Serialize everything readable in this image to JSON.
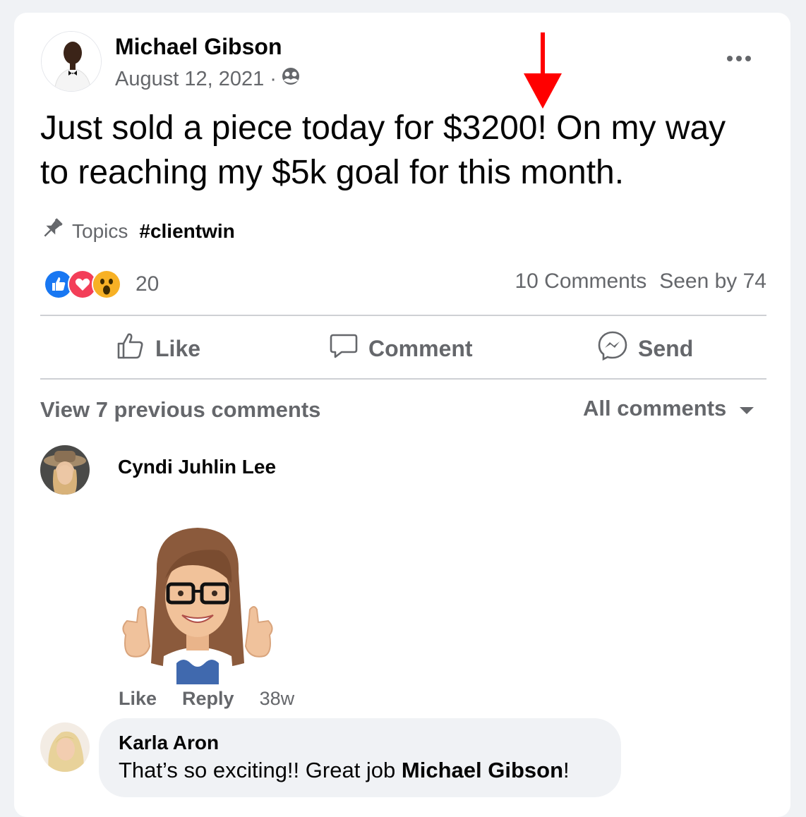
{
  "post": {
    "author": "Michael Gibson",
    "date": "August 12, 2021 ·",
    "text": "Just sold a piece today for $3200! On my way to reaching my $5k goal for this month.",
    "topics_label": "Topics",
    "hashtag": "#clientwin",
    "reaction_count": "20",
    "comments_count": "10 Comments",
    "seen_by": "Seen by 74"
  },
  "actions": {
    "like": "Like",
    "comment": "Comment",
    "send": "Send"
  },
  "comments_section": {
    "view_previous": "View 7 previous comments",
    "filter": "All comments"
  },
  "comments": [
    {
      "author": "Cyndi Juhlin Lee",
      "like": "Like",
      "reply": "Reply",
      "time": "38w"
    },
    {
      "author": "Karla Aron",
      "text_before": "That’s so exciting!! Great job ",
      "mention": "Michael Gibson",
      "text_after": "!"
    }
  ],
  "colors": {
    "secondary_text": "#65676b",
    "divider": "#ced0d4",
    "like_blue": "#1877f2",
    "love_red": "#f33e58",
    "annotation_arrow": "#ff0000"
  },
  "icons": [
    "more-icon",
    "friends-icon",
    "pin-icon",
    "like-reaction-icon",
    "love-reaction-icon",
    "wow-reaction-icon",
    "thumbs-up-icon",
    "comment-icon",
    "messenger-icon",
    "caret-down-icon"
  ]
}
